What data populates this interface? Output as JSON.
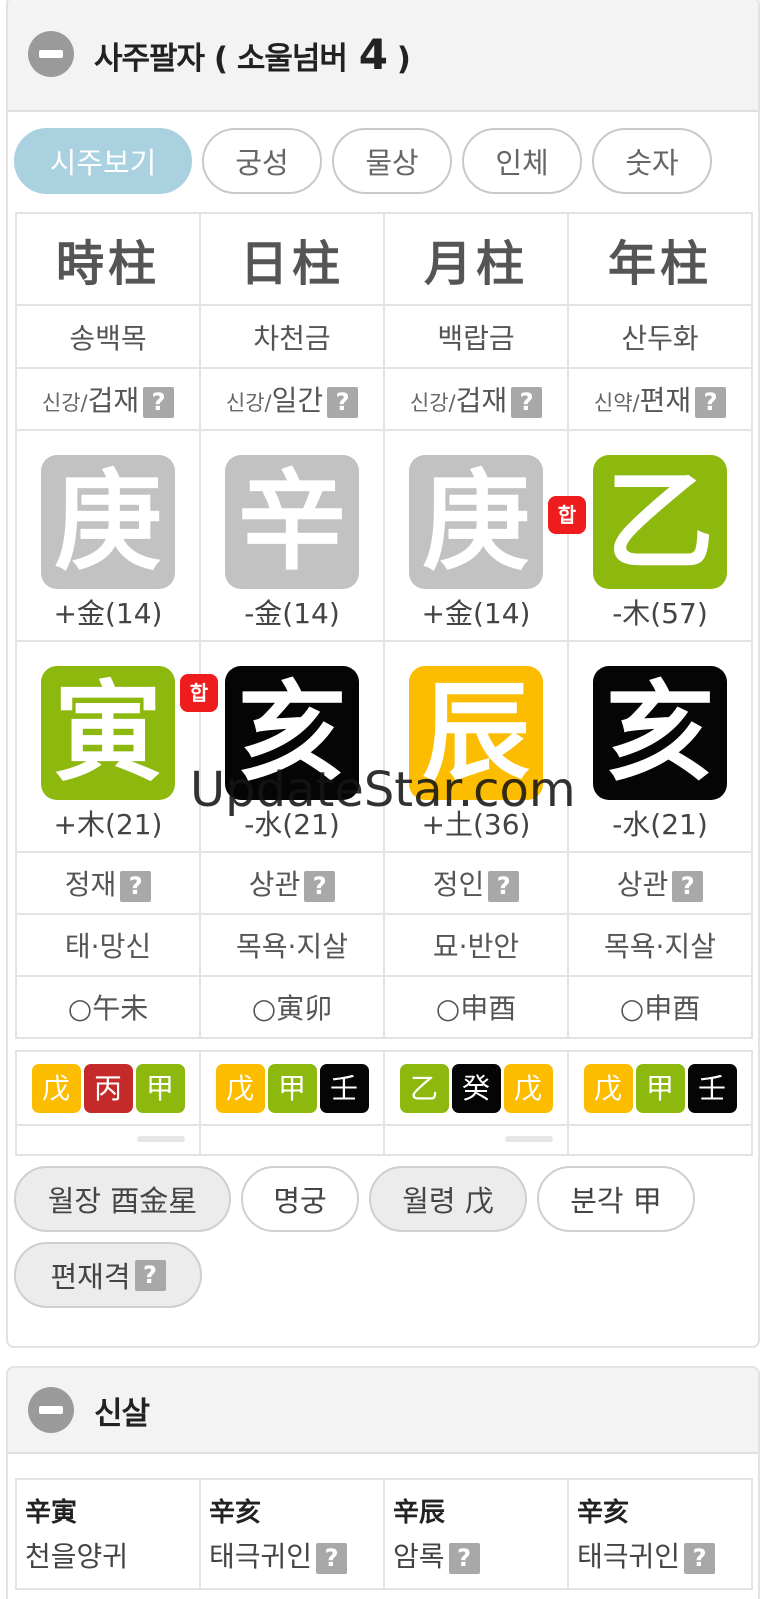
{
  "header": {
    "title": "사주팔자 ( 소울넘버",
    "soul_number": "4",
    "title_end": ")"
  },
  "tabs": [
    "시주보기",
    "궁성",
    "물상",
    "인체",
    "숫자"
  ],
  "pillars": [
    {
      "head": "時柱",
      "napeum": "송백목",
      "sin_small": "신강/",
      "sin_main": "겁재",
      "stem": "庚",
      "stem_color": "#c2c2c2",
      "stem_val": "+金(14)",
      "branch": "寅",
      "branch_color": "#8db80e",
      "branch_val": "+木(21)",
      "sipsin": "정재",
      "unseong": "태·망신",
      "gongmang": "○午未"
    },
    {
      "head": "日柱",
      "napeum": "차천금",
      "sin_small": "신강/",
      "sin_main": "일간",
      "stem": "辛",
      "stem_color": "#c2c2c2",
      "stem_val": "-金(14)",
      "branch": "亥",
      "branch_color": "#050505",
      "branch_val": "-水(21)",
      "sipsin": "상관",
      "unseong": "목욕·지살",
      "gongmang": "○寅卯"
    },
    {
      "head": "月柱",
      "napeum": "백랍금",
      "sin_small": "신강/",
      "sin_main": "겁재",
      "stem": "庚",
      "stem_color": "#c2c2c2",
      "stem_val": "+金(14)",
      "branch": "辰",
      "branch_color": "#fcbd00",
      "branch_val": "+土(36)",
      "sipsin": "정인",
      "unseong": "묘·반안",
      "gongmang": "○申酉"
    },
    {
      "head": "年柱",
      "napeum": "산두화",
      "sin_small": "신약/",
      "sin_main": "편재",
      "stem": "乙",
      "stem_color": "#8db80e",
      "stem_val": "-木(57)",
      "branch": "亥",
      "branch_color": "#050505",
      "branch_val": "-水(21)",
      "sipsin": "상관",
      "unseong": "목욕·지살",
      "gongmang": "○申酉"
    }
  ],
  "hap_label": "합",
  "help_icon": "?",
  "jijanggan": [
    [
      {
        "c": "戊",
        "color": "yellow"
      },
      {
        "c": "丙",
        "color": "red"
      },
      {
        "c": "甲",
        "color": "green"
      }
    ],
    [
      {
        "c": "戊",
        "color": "yellow"
      },
      {
        "c": "甲",
        "color": "green"
      },
      {
        "c": "壬",
        "color": "black"
      }
    ],
    [
      {
        "c": "乙",
        "color": "green"
      },
      {
        "c": "癸",
        "color": "black"
      },
      {
        "c": "戊",
        "color": "yellow"
      }
    ],
    [
      {
        "c": "戊",
        "color": "yellow"
      },
      {
        "c": "甲",
        "color": "green"
      },
      {
        "c": "壬",
        "color": "black"
      }
    ]
  ],
  "pills": {
    "woljang": "월장 酉金星",
    "myeonggung": "명궁",
    "wollyeong": "월령 戊",
    "bungak": "분각 甲",
    "gyeok": "편재격"
  },
  "sinsal": {
    "title": "신살",
    "cols": [
      {
        "top": "辛寅",
        "bot": "천을양귀",
        "help": false
      },
      {
        "top": "辛亥",
        "bot": "태극귀인",
        "help": true
      },
      {
        "top": "辛辰",
        "bot": "암록",
        "help": true
      },
      {
        "top": "辛亥",
        "bot": "태극귀인",
        "help": true
      }
    ]
  },
  "watermark": "UpdateStar.com"
}
